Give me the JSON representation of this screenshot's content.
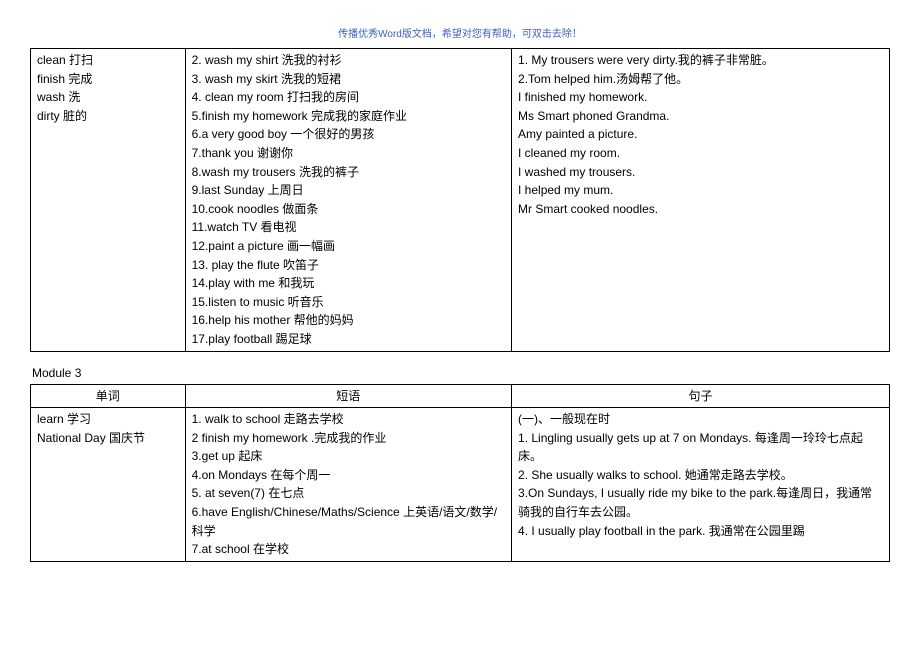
{
  "header_note": "传播优秀Word版文档，希望对您有帮助，可双击去除！",
  "module2": {
    "col1": [
      "clean 打扫",
      "finish 完成",
      "wash 洗",
      "dirty 脏的"
    ],
    "col2": [
      "2. wash my shirt 洗我的衬衫",
      "3. wash my skirt 洗我的短裙",
      "4. clean my room 打扫我的房间",
      "5.finish my homework 完成我的家庭作业",
      "6.a very good boy 一个很好的男孩",
      "7.thank you 谢谢你",
      "8.wash my trousers 洗我的裤子",
      "9.last Sunday 上周日",
      "10.cook noodles 做面条",
      "11.watch TV 看电视",
      "12.paint a picture 画一幅画",
      "13. play the flute 吹笛子",
      "14.play with me  和我玩",
      "15.listen to music 听音乐",
      "16.help his mother 帮他的妈妈",
      "17.play football 踢足球"
    ],
    "col3": [
      "1. My trousers were very dirty.我的裤子非常脏。",
      "2.Tom helped him.汤姆帮了他。",
      "I finished my homework.",
      "Ms Smart phoned Grandma.",
      "Amy painted a picture.",
      "I cleaned my room.",
      "I washed my trousers.",
      "I helped my mum.",
      "Mr Smart cooked noodles."
    ]
  },
  "module3": {
    "title": "Module 3",
    "headers": {
      "col1": "单词",
      "col2": "短语",
      "col3": "句子"
    },
    "col1": [
      "learn 学习",
      "National Day 国庆节"
    ],
    "col2": [
      "1. walk to school  走路去学校",
      "2 finish my homework .完成我的作业",
      "3.get up  起床",
      "4.on Mondays  在每个周一",
      "5. at seven(7)  在七点",
      "6.have English/Chinese/Maths/Science 上英语/语文/数学/科学",
      "7.at school   在学校"
    ],
    "col3": [
      "(一)、一般现在时",
      "1. Lingling usually gets up at 7 on Mondays.  每逢周一玲玲七点起床。",
      "2. She usually walks to school.  她通常走路去学校。",
      "3.On Sundays, I usually ride my bike to the park.每逢周日，我通常骑我的自行车去公园。",
      "4. I usually play football in the park.  我通常在公园里踢"
    ]
  }
}
